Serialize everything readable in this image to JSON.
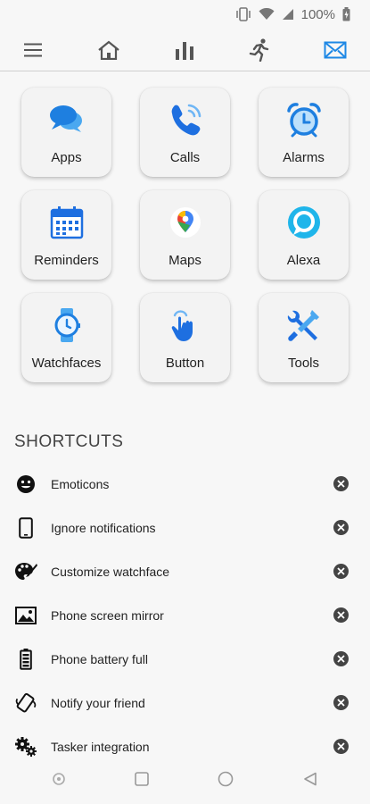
{
  "status_bar": {
    "battery_text": "100%"
  },
  "nav": {
    "items": [
      {
        "icon": "menu-icon"
      },
      {
        "icon": "home-icon"
      },
      {
        "icon": "bar-chart-icon"
      },
      {
        "icon": "running-icon"
      },
      {
        "icon": "mail-icon",
        "active": true
      }
    ],
    "accent_color": "#1e88e5"
  },
  "tiles": [
    {
      "label": "Apps",
      "icon": "chat-bubbles-icon"
    },
    {
      "label": "Calls",
      "icon": "phone-icon"
    },
    {
      "label": "Alarms",
      "icon": "alarm-clock-icon"
    },
    {
      "label": "Reminders",
      "icon": "calendar-icon"
    },
    {
      "label": "Maps",
      "icon": "maps-pin-icon"
    },
    {
      "label": "Alexa",
      "icon": "alexa-icon"
    },
    {
      "label": "Watchfaces",
      "icon": "watch-icon"
    },
    {
      "label": "Button",
      "icon": "tap-hand-icon"
    },
    {
      "label": "Tools",
      "icon": "tools-icon"
    }
  ],
  "shortcuts": {
    "title": "SHORTCUTS",
    "items": [
      {
        "label": "Emoticons",
        "icon": "smiley-icon"
      },
      {
        "label": "Ignore notifications",
        "icon": "smartphone-icon"
      },
      {
        "label": "Customize watchface",
        "icon": "palette-icon"
      },
      {
        "label": "Phone screen mirror",
        "icon": "image-icon"
      },
      {
        "label": "Phone battery full",
        "icon": "battery-icon"
      },
      {
        "label": "Notify your friend",
        "icon": "vibrate-icon"
      },
      {
        "label": "Tasker integration",
        "icon": "gears-icon"
      }
    ]
  }
}
